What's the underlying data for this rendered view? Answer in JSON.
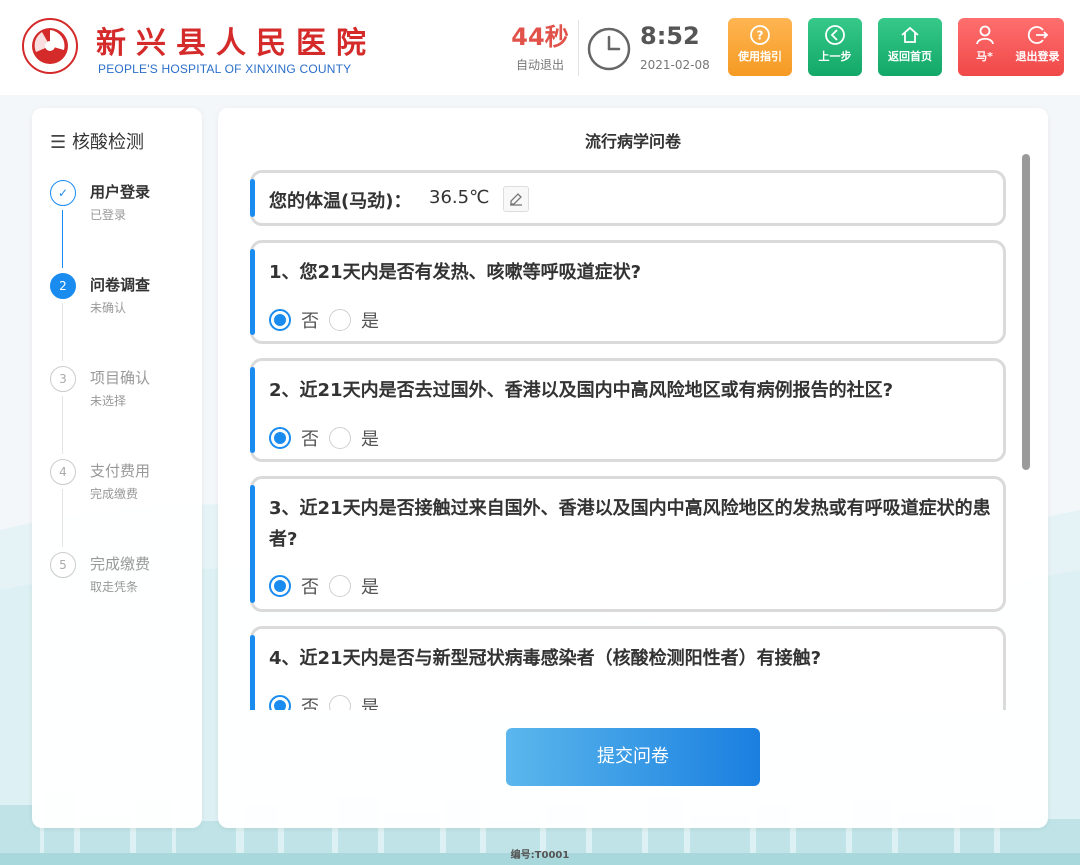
{
  "header": {
    "hospital_name_cn": "新兴县人民医院",
    "hospital_name_en": "PEOPLE'S HOSPITAL OF XINXING COUNTY",
    "countdown_value": "44秒",
    "countdown_label": "自动退出",
    "time": "8:52",
    "date": "2021-02-08",
    "buttons": {
      "guide": "使用指引",
      "prev": "上一步",
      "home": "返回首页",
      "user": "马*",
      "logout": "退出登录"
    },
    "colors": {
      "brand_red": "#d42a2a",
      "guide": "#f59a23",
      "green": "#13a867",
      "red": "#f04848"
    }
  },
  "sidebar": {
    "title": "核酸检测",
    "steps": [
      {
        "num": "✓",
        "title": "用户登录",
        "sub": "已登录",
        "state": "done"
      },
      {
        "num": "2",
        "title": "问卷调查",
        "sub": "未确认",
        "state": "active"
      },
      {
        "num": "3",
        "title": "项目确认",
        "sub": "未选择",
        "state": "todo"
      },
      {
        "num": "4",
        "title": "支付费用",
        "sub": "完成缴费",
        "state": "todo"
      },
      {
        "num": "5",
        "title": "完成缴费",
        "sub": "取走凭条",
        "state": "todo"
      }
    ]
  },
  "main": {
    "title": "流行病学问卷",
    "temperature_label": "您的体温(马劲)：",
    "temperature_value": "36.5℃",
    "option_no": "否",
    "option_yes": "是",
    "questions": [
      {
        "text": "1、您21天内是否有发热、咳嗽等呼吸道症状?",
        "answer": "否"
      },
      {
        "text": "2、近21天内是否去过国外、香港以及国内中高风险地区或有病例报告的社区?",
        "answer": "否"
      },
      {
        "text": "3、近21天内是否接触过来自国外、香港以及国内中高风险地区的发热或有呼吸道症状的患者?",
        "answer": "否"
      },
      {
        "text": "4、近21天内是否与新型冠状病毒感染者（核酸检测阳性者）有接触?",
        "answer": "否"
      }
    ],
    "submit_label": "提交问卷",
    "accent_color": "#1a8cf0"
  },
  "footer": {
    "code": "编号:T0001"
  }
}
